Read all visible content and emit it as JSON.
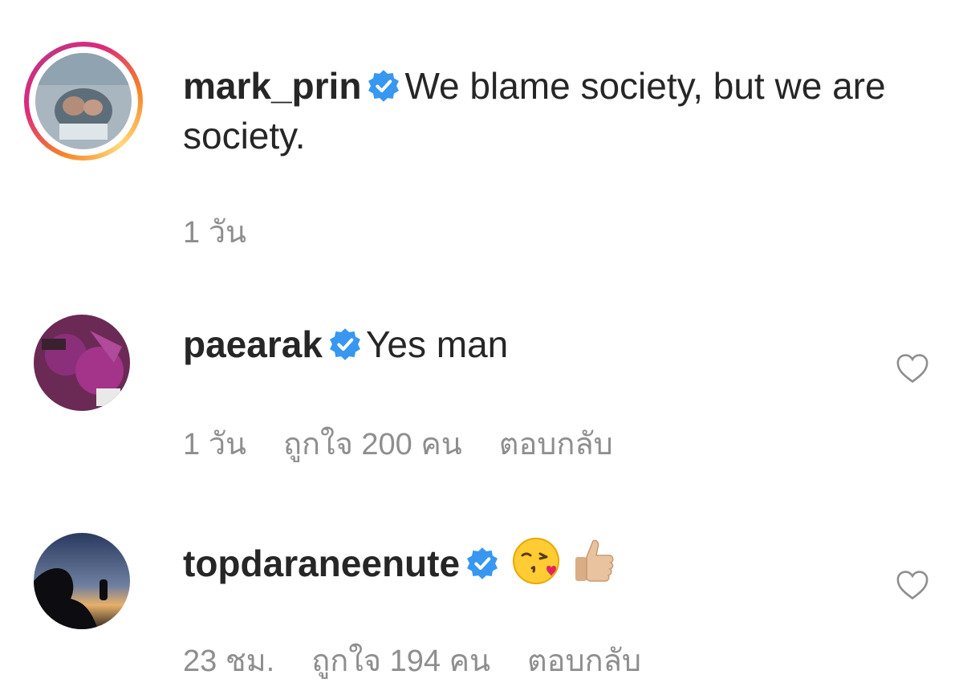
{
  "comments": [
    {
      "username": "mark_prin",
      "verified": true,
      "text": "We blame society, but we are society.",
      "time": "1 วัน",
      "likes": "",
      "reply": "",
      "has_story_ring": true
    },
    {
      "username": "paearak",
      "verified": true,
      "text": "Yes man",
      "time": "1 วัน",
      "likes": "ถูกใจ 200 คน",
      "reply": "ตอบกลับ",
      "has_story_ring": false
    },
    {
      "username": "topdaraneenute",
      "verified": true,
      "text": "",
      "emojis": [
        "kissing-face-emoji",
        "thumbs-up-emoji"
      ],
      "time": "23 ชม.",
      "likes": "ถูกใจ 194 คน",
      "reply": "ตอบกลับ",
      "has_story_ring": false
    }
  ],
  "colors": {
    "username": "#262626",
    "meta": "#8e8e8e",
    "verified_badge": "#3897f0",
    "heart_outline": "#8e8e8e"
  }
}
